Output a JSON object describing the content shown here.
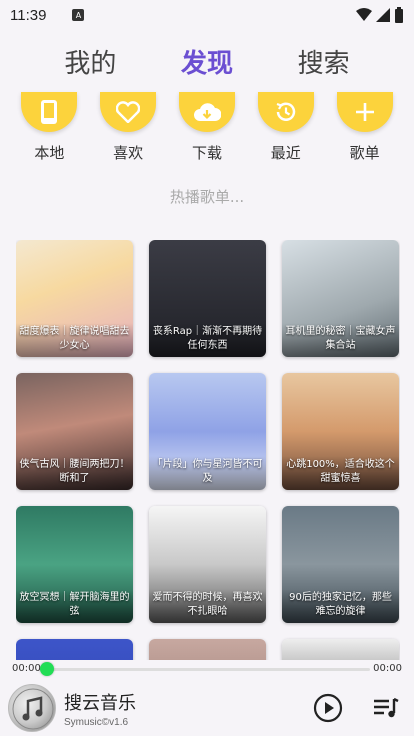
{
  "status_bar": {
    "time": "11:39",
    "notification_icon": "A"
  },
  "tabs": [
    {
      "label": "我的",
      "active": false
    },
    {
      "label": "发现",
      "active": true
    },
    {
      "label": "搜索",
      "active": false
    }
  ],
  "colors": {
    "accent": "#6b4fd2",
    "quick_action": "#fcd33c",
    "progress": "#22c55e"
  },
  "quick_actions": [
    {
      "label": "本地",
      "icon": "phone-icon"
    },
    {
      "label": "喜欢",
      "icon": "heart-icon"
    },
    {
      "label": "下载",
      "icon": "cloud-download-icon"
    },
    {
      "label": "最近",
      "icon": "history-icon"
    },
    {
      "label": "歌单",
      "icon": "plus-icon"
    }
  ],
  "section_title": "热播歌单...",
  "playlists": [
    {
      "title": "甜度爆表｜旋律说唱甜去少女心"
    },
    {
      "title": "丧系Rap｜渐渐不再期待任何东西"
    },
    {
      "title": "耳机里的秘密｜宝藏女声集合站"
    },
    {
      "title": "侠气古风｜腰间两把刀！断和了"
    },
    {
      "title": "「片段」你与星河皆不可及"
    },
    {
      "title": "心跳100%，适合收这个甜蜜惊喜"
    },
    {
      "title": "放空冥想｜解开脑海里的弦"
    },
    {
      "title": "爱而不得的时候，再喜欢不扎眼哈"
    },
    {
      "title": "90后的独家记忆，那些难忘的旋律"
    },
    {
      "title": ""
    },
    {
      "title": ""
    },
    {
      "title": ""
    }
  ],
  "player": {
    "time_current": "00:00",
    "time_total": "00:00",
    "progress": 0,
    "name": "搜云音乐",
    "subtitle": "Symusic©v1.6"
  }
}
